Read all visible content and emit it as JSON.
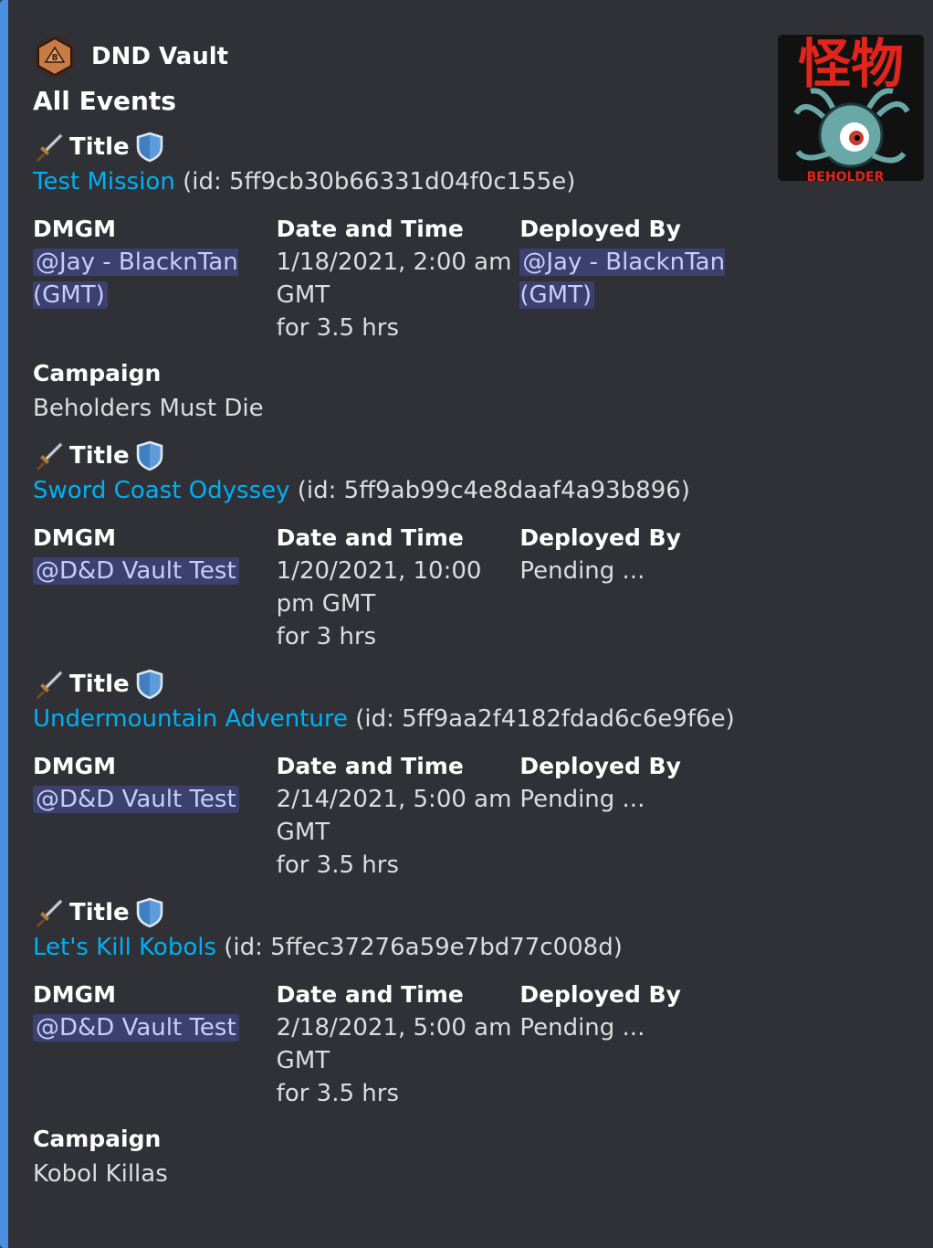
{
  "author": {
    "name": "DND Vault",
    "icon": "d20-dice-icon"
  },
  "title": "All Events",
  "thumbnail": {
    "icon": "beholder-monster-image",
    "caption": "BEHOLDER"
  },
  "field_labels": {
    "title": "Title",
    "dmgm": "DMGM",
    "datetime": "Date and Time",
    "deployed": "Deployed By",
    "campaign": "Campaign"
  },
  "events": [
    {
      "name": "Test Mission",
      "id_text": "(id: 5ff9cb30b66331d04f0c155e)",
      "dmgm": "@Jay - BlacknTan (GMT)",
      "datetime_lines": [
        "1/18/2021, 2:00 am",
        "GMT",
        "for 3.5 hrs"
      ],
      "deployed_by": "@Jay - BlacknTan (GMT)",
      "campaign": "Beholders Must Die"
    },
    {
      "name": "Sword Coast Odyssey",
      "id_text": "(id: 5ff9ab99c4e8daaf4a93b896)",
      "dmgm": "@D&D Vault Test",
      "datetime_lines": [
        "1/20/2021, 10:00",
        "pm GMT",
        "for 3 hrs"
      ],
      "deployed_by": "Pending ..."
    },
    {
      "name": "Undermountain Adventure",
      "id_text": "(id: 5ff9aa2f4182fdad6c6e9f6e)",
      "dmgm": "@D&D Vault Test",
      "datetime_lines": [
        "2/14/2021, 5:00 am",
        "GMT",
        "for 3.5 hrs"
      ],
      "deployed_by": "Pending ..."
    },
    {
      "name": "Let's Kill Kobols",
      "id_text": "(id: 5ffec37276a59e7bd77c008d)",
      "dmgm": "@D&D Vault Test",
      "datetime_lines": [
        "2/18/2021, 5:00 am",
        "GMT",
        "for 3.5 hrs"
      ],
      "deployed_by": "Pending ...",
      "campaign": "Kobol Killas"
    }
  ],
  "colors": {
    "embed_bar": "#4a90e2",
    "link": "#00b0f4",
    "background": "#2f3136"
  }
}
